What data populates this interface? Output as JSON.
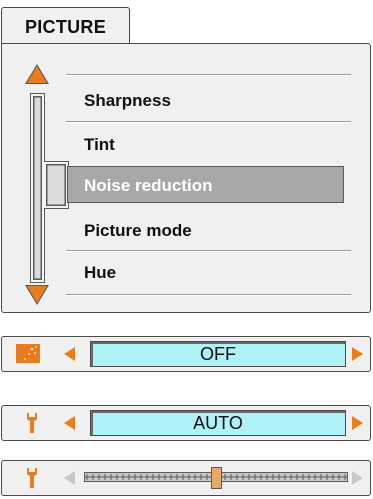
{
  "tab": {
    "title": "PICTURE"
  },
  "menu": {
    "items": [
      {
        "label": "Sharpness"
      },
      {
        "label": "Tint"
      },
      {
        "label": "Noise reduction",
        "selected": true
      },
      {
        "label": "Picture mode"
      },
      {
        "label": "Hue"
      }
    ]
  },
  "controls": {
    "noise_reduction": {
      "icon": "noise-reduction-icon",
      "value": "OFF"
    },
    "picture_mode": {
      "icon": "wrench-icon",
      "value": "AUTO"
    },
    "adjust_slider": {
      "icon": "wrench-icon",
      "level": 0.5
    }
  },
  "colors": {
    "accent": "#e87c1e",
    "field": "#aef1f7",
    "highlight": "#a8a8a8",
    "panel": "#f0f0f0"
  }
}
